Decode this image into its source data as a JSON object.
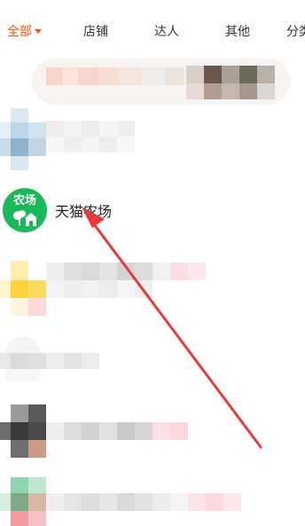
{
  "tabs": [
    {
      "label": "全部",
      "active": true
    },
    {
      "label": "店铺",
      "active": false
    },
    {
      "label": "达人",
      "active": false
    },
    {
      "label": "其他",
      "active": false
    },
    {
      "label": "分类",
      "active": false
    }
  ],
  "farm_item": {
    "icon_text": "农场",
    "title": "天猫农场"
  },
  "colors": {
    "accent": "#ff5000",
    "farm_green": "#19b95a",
    "arrow_red": "#e8383c"
  }
}
